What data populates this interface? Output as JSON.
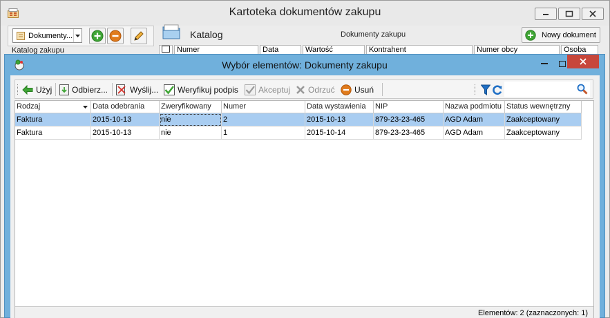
{
  "background_window": {
    "title": "Kartoteka dokumentów zakupu",
    "combo_value": "Dokumenty...",
    "katalog_label": "Katalog zakupu",
    "katalog_title": "Katalog",
    "documents_label": "Dokumenty zakupu",
    "new_document_label": "Nowy dokument",
    "columns": [
      "Numer",
      "Data",
      "Wartość",
      "Kontrahent",
      "Numer obcy",
      "Osoba"
    ]
  },
  "dialog": {
    "title": "Wybór elementów: Dokumenty zakupu",
    "toolbar": {
      "use_label": "Użyj",
      "receive_label": "Odbierz...",
      "send_label": "Wyślij...",
      "verify_label": "Weryfikuj podpis",
      "accept_label": "Akceptuj",
      "reject_label": "Odrzuć",
      "delete_label": "Usuń",
      "search_value": ""
    },
    "grid": {
      "columns": [
        "Rodzaj",
        "Data odebrania",
        "Zweryfikowany",
        "Numer",
        "Data wystawienia",
        "NIP",
        "Nazwa podmiotu",
        "Status wewnętrzny"
      ],
      "rows": [
        [
          "Faktura",
          "2015-10-13",
          "nie",
          "2",
          "2015-10-13",
          "879-23-23-465",
          "AGD Adam",
          "Zaakceptowany"
        ],
        [
          "Faktura",
          "2015-10-13",
          "nie",
          "1",
          "2015-10-14",
          "879-23-23-465",
          "AGD Adam",
          "Zaakceptowany"
        ]
      ],
      "selected_row": 0
    },
    "status": "Elementów: 2 (zaznaczonych: 1)"
  },
  "colors": {
    "dialog_frame": "#70b0dc",
    "selection": "#a9cdf1",
    "close_button": "#c7463b",
    "green_icon": "#3fa535",
    "orange_icon": "#e07b1c",
    "blue_icon": "#1f6fc5"
  }
}
